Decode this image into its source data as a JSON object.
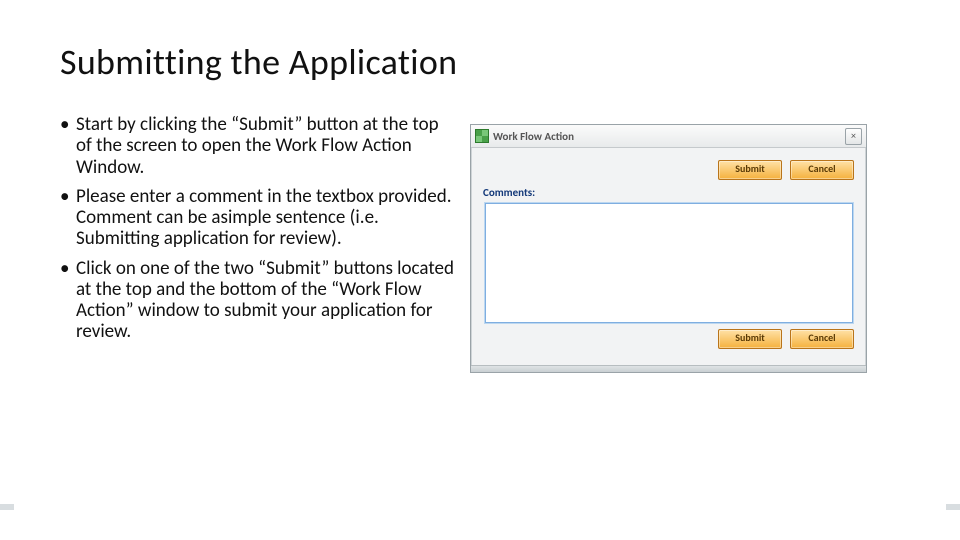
{
  "title": "Submitting the Application",
  "bullets": [
    "Start by clicking the “Submit” button at the top of the screen to open the Work Flow Action Window.",
    "Please enter a comment in the textbox provided. Comment can be asimple sentence (i.e. Submitting application for review).",
    "Click on one of the two “Submit” buttons located at the top and the bottom of the “Work Flow Action” window to submit your application for review."
  ],
  "panel": {
    "header_title": "Work Flow Action",
    "close_glyph": "×",
    "comments_label": "Comments:",
    "buttons": {
      "submit": "Submit",
      "cancel": "Cancel"
    },
    "textarea_value": ""
  }
}
